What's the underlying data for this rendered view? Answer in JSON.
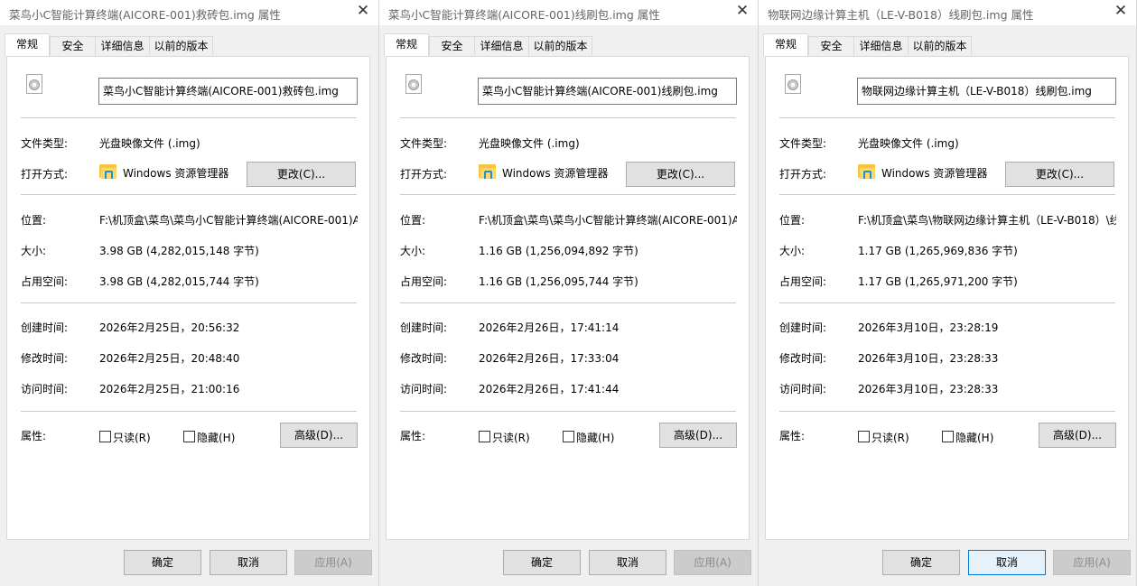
{
  "common": {
    "tabs": [
      "常规",
      "安全",
      "详细信息",
      "以前的版本"
    ],
    "labels": {
      "file_type": "文件类型:",
      "opens_with": "打开方式:",
      "location": "位置:",
      "size": "大小:",
      "size_on_disk": "占用空间:",
      "created": "创建时间:",
      "modified": "修改时间:",
      "accessed": "访问时间:",
      "attributes": "属性:"
    },
    "file_type_value": "光盘映像文件 (.img)",
    "opens_with_value": "Windows 资源管理器",
    "change_button": "更改(C)...",
    "readonly": "只读(R)",
    "hidden": "隐藏(H)",
    "advanced_button": "高级(D)...",
    "ok": "确定",
    "cancel": "取消",
    "apply": "应用(A)",
    "close_glyph": "✕"
  },
  "dialogs": [
    {
      "title": "菜鸟小C智能计算终端(AICORE-001)救砖包.img 属性",
      "filename": "菜鸟小C智能计算终端(AICORE-001)救砖包.img",
      "location": "F:\\机顶盒\\菜鸟\\菜鸟小C智能计算终端(AICORE-001)A",
      "size": "3.98 GB (4,282,015,148 字节)",
      "size_on_disk": "3.98 GB (4,282,015,744 字节)",
      "created": "2026年2月25日，20:56:32",
      "modified": "2026年2月25日，20:48:40",
      "accessed": "2026年2月25日，21:00:16",
      "readonly": false,
      "hidden": false
    },
    {
      "title": "菜鸟小C智能计算终端(AICORE-001)线刷包.img 属性",
      "filename": "菜鸟小C智能计算终端(AICORE-001)线刷包.img",
      "location": "F:\\机顶盒\\菜鸟\\菜鸟小C智能计算终端(AICORE-001)A",
      "size": "1.16 GB (1,256,094,892 字节)",
      "size_on_disk": "1.16 GB (1,256,095,744 字节)",
      "created": "2026年2月26日，17:41:14",
      "modified": "2026年2月26日，17:33:04",
      "accessed": "2026年2月26日，17:41:44",
      "readonly": false,
      "hidden": false
    },
    {
      "title": "物联网边缘计算主机（LE-V-B018）线刷包.img 属性",
      "filename": "物联网边缘计算主机（LE-V-B018）线刷包.img",
      "location": "F:\\机顶盒\\菜鸟\\物联网边缘计算主机（LE-V-B018）\\线",
      "size": "1.17 GB (1,265,969,836 字节)",
      "size_on_disk": "1.17 GB (1,265,971,200 字节)",
      "created": "2026年3月10日，23:28:19",
      "modified": "2026年3月10日，23:28:33",
      "accessed": "2026年3月10日，23:28:33",
      "readonly": false,
      "hidden": false
    }
  ]
}
